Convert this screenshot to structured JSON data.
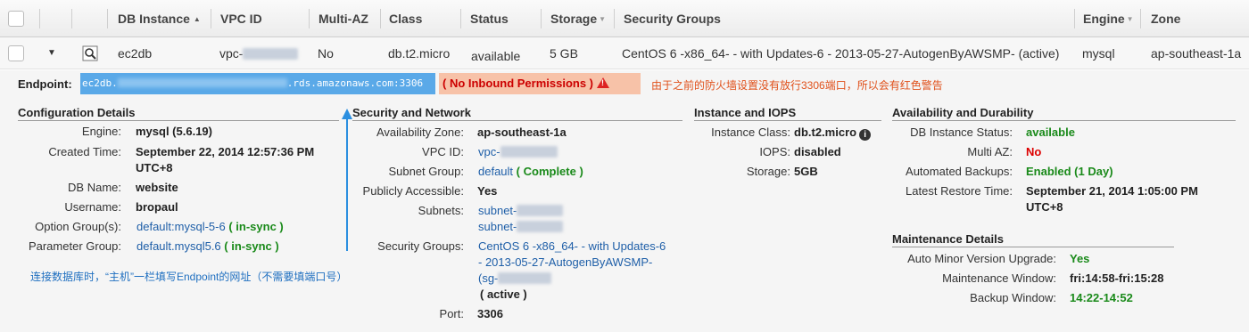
{
  "header": {
    "columns": [
      "DB Instance",
      "VPC ID",
      "Multi-AZ",
      "Class",
      "Status",
      "Storage",
      "Security Groups",
      "Engine",
      "Zone"
    ]
  },
  "row": {
    "db_instance": "ec2db",
    "vpc_id": "vpc-",
    "multi_az": "No",
    "class": "db.t2.micro",
    "status": "available",
    "storage": "5 GB",
    "security_groups": "CentOS 6 -x86_64- - with Updates-6 - 2013-05-27-AutogenByAWSMP- (active)",
    "engine": "mysql",
    "zone": "ap-southeast-1a"
  },
  "endpoint": {
    "label": "Endpoint:",
    "prefix": "ec2db.",
    "suffix": ".rds.amazonaws.com:3306",
    "warning": "( No Inbound Permissions )",
    "annotation": "由于之前的防火墙设置没有放行3306端口，所以会有红色警告"
  },
  "configuration": {
    "title": "Configuration Details",
    "engine_label": "Engine:",
    "engine": "mysql (5.6.19)",
    "created_label": "Created Time:",
    "created": "September 22, 2014 12:57:36 PM",
    "created_tz": "UTC+8",
    "dbname_label": "DB Name:",
    "dbname": "website",
    "username_label": "Username:",
    "username": "bropaul",
    "option_label": "Option Group(s):",
    "option": "default:mysql-5-6",
    "option_status": "( in-sync )",
    "param_label": "Parameter Group:",
    "param": "default.mysql5.6",
    "param_status": "( in-sync )"
  },
  "security": {
    "title": "Security and Network",
    "az_label": "Availability Zone:",
    "az": "ap-southeast-1a",
    "vpc_label": "VPC ID:",
    "vpc": "vpc-",
    "subnet_group_label": "Subnet Group:",
    "subnet_group": "default",
    "subnet_group_status": "( Complete )",
    "public_label": "Publicly Accessible:",
    "public": "Yes",
    "subnets_label": "Subnets:",
    "subnet1": "subnet-",
    "subnet2": "subnet-",
    "sg_label": "Security Groups:",
    "sg_line1": "CentOS 6 -x86_64- - with Updates-6",
    "sg_line2": "- 2013-05-27-AutogenByAWSMP-",
    "sg_line3": "(sg-",
    "sg_status": "( active )",
    "port_label": "Port:",
    "port": "3306"
  },
  "instance": {
    "title": "Instance and IOPS",
    "class_label": "Instance Class:",
    "class": "db.t2.micro",
    "iops_label": "IOPS:",
    "iops": "disabled",
    "storage_label": "Storage:",
    "storage": "5GB"
  },
  "availability": {
    "title": "Availability and Durability",
    "status_label": "DB Instance Status:",
    "status": "available",
    "multiaz_label": "Multi AZ:",
    "multiaz": "No",
    "backups_label": "Automated Backups:",
    "backups": "Enabled (1 Day)",
    "restore_label": "Latest Restore Time:",
    "restore": "September 21, 2014 1:05:00 PM",
    "restore_tz": "UTC+8"
  },
  "maintenance": {
    "title": "Maintenance Details",
    "minor_label": "Auto Minor Version Upgrade:",
    "minor": "Yes",
    "window_label": "Maintenance Window:",
    "window": "fri:14:58-fri:15:28",
    "backup_label": "Backup Window:",
    "backup": "14:22-14:52"
  },
  "annotation_host": "连接数据库时，“主机”一栏填写Endpoint的网址（不需要填端口号）",
  "colors": {
    "accent_blue": "#5aa9e8",
    "warning_bg": "#f7c2a8",
    "ok_green": "#1a8a1a",
    "annotation_red": "#e0501a"
  }
}
